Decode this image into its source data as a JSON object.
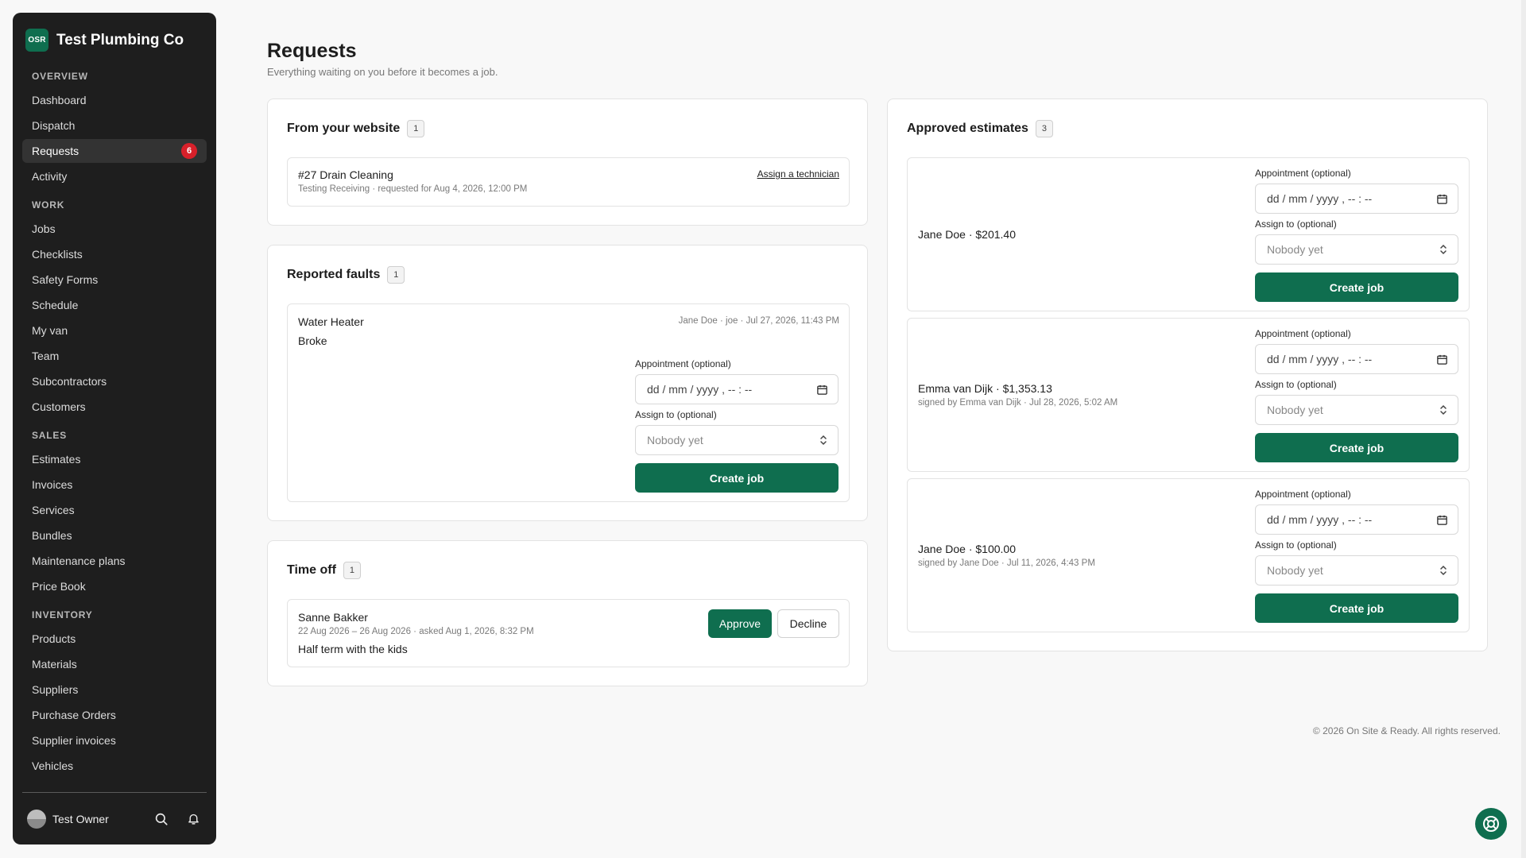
{
  "brand": {
    "logo": "OSR",
    "name": "Test Plumbing Co"
  },
  "nav": {
    "overview": {
      "heading": "OVERVIEW",
      "items": [
        "Dashboard",
        "Dispatch",
        "Requests",
        "Activity"
      ]
    },
    "work": {
      "heading": "WORK",
      "items": [
        "Jobs",
        "Checklists",
        "Safety Forms",
        "Schedule",
        "My van",
        "Team",
        "Subcontractors",
        "Customers"
      ]
    },
    "sales": {
      "heading": "SALES",
      "items": [
        "Estimates",
        "Invoices",
        "Services",
        "Bundles",
        "Maintenance plans",
        "Price Book"
      ]
    },
    "inventory": {
      "heading": "INVENTORY",
      "items": [
        "Products",
        "Materials",
        "Suppliers",
        "Purchase Orders",
        "Supplier invoices",
        "Vehicles"
      ]
    },
    "requests_badge": "6"
  },
  "footer": {
    "owner": "Test Owner"
  },
  "page": {
    "title": "Requests",
    "subtitle": "Everything waiting on you before it becomes a job."
  },
  "website": {
    "title": "From your website",
    "count": "1",
    "item": {
      "title": "#27 Drain Cleaning",
      "meta": "Testing Receiving · requested for Aug 4, 2026, 12:00 PM",
      "link": "Assign a technician"
    }
  },
  "faults": {
    "title": "Reported faults",
    "count": "1",
    "item": {
      "title": "Water Heater",
      "desc": "Broke",
      "meta": "Jane Doe · joe · Jul 27, 2026, 11:43 PM",
      "appt_label": "Appointment (optional)",
      "appt_placeholder": "dd / mm / yyyy ,  -- : --",
      "assign_label": "Assign to (optional)",
      "assign_value": "Nobody yet",
      "button": "Create job"
    }
  },
  "timeoff": {
    "title": "Time off",
    "count": "1",
    "item": {
      "name": "Sanne Bakker",
      "meta": "22 Aug 2026 – 26 Aug 2026 · asked Aug 1, 2026, 8:32 PM",
      "note": "Half term with the kids",
      "approve": "Approve",
      "decline": "Decline"
    }
  },
  "approved": {
    "title": "Approved estimates",
    "count": "3",
    "items": [
      {
        "title": "Jane Doe · $201.40",
        "meta": "",
        "appt_label": "Appointment (optional)",
        "appt_placeholder": "dd / mm / yyyy ,  -- : --",
        "assign_label": "Assign to (optional)",
        "assign_value": "Nobody yet",
        "button": "Create job"
      },
      {
        "title": "Emma van Dijk · $1,353.13",
        "meta": "signed by Emma van Dijk · Jul 28, 2026, 5:02 AM",
        "appt_label": "Appointment (optional)",
        "appt_placeholder": "dd / mm / yyyy ,  -- : --",
        "assign_label": "Assign to (optional)",
        "assign_value": "Nobody yet",
        "button": "Create job"
      },
      {
        "title": "Jane Doe · $100.00",
        "meta": "signed by Jane Doe · Jul 11, 2026, 4:43 PM",
        "appt_label": "Appointment (optional)",
        "appt_placeholder": "dd / mm / yyyy ,  -- : --",
        "assign_label": "Assign to (optional)",
        "assign_value": "Nobody yet",
        "button": "Create job"
      }
    ]
  },
  "copyright": "© 2026 On Site & Ready. All rights reserved.",
  "colors": {
    "accent": "#0f6e4f",
    "sidebar": "#1e1e1e",
    "badge": "#d8202a"
  }
}
